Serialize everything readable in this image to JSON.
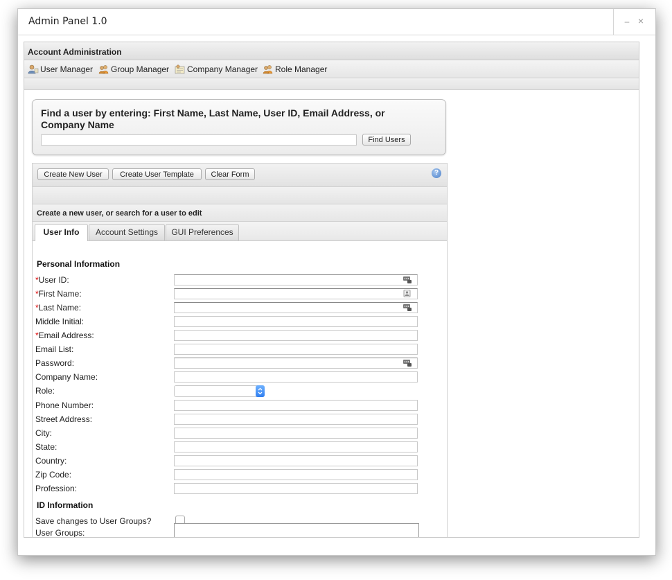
{
  "window": {
    "title": "Admin Panel 1.0",
    "minimize_glyph": "–",
    "close_glyph": "×"
  },
  "header": {
    "section_title": "Account Administration",
    "nav": [
      {
        "label": "User Manager",
        "icon": "user-manager-icon"
      },
      {
        "label": "Group Manager",
        "icon": "group-manager-icon"
      },
      {
        "label": "Company Manager",
        "icon": "company-manager-icon"
      },
      {
        "label": "Role Manager",
        "icon": "role-manager-icon"
      }
    ]
  },
  "search": {
    "heading": "Find a user by entering: First Name, Last Name, User ID, Email Address, or Company Name",
    "input_value": "",
    "button_label": "Find Users"
  },
  "toolbar": {
    "create_user_label": "Create New User",
    "create_template_label": "Create User Template",
    "clear_form_label": "Clear Form",
    "help_glyph": "?"
  },
  "form": {
    "subtitle": "Create a new user, or search for a user to edit",
    "tabs": [
      {
        "label": "User Info",
        "active": true
      },
      {
        "label": "Account Settings",
        "active": false
      },
      {
        "label": "GUI Preferences",
        "active": false
      }
    ],
    "personal_heading": "Personal Information",
    "required_marker": "*",
    "fields": [
      {
        "label": "User ID:",
        "required": true,
        "value": "",
        "icon": "keychain-icon"
      },
      {
        "label": "First Name:",
        "required": true,
        "value": "",
        "icon": "contact-card-icon"
      },
      {
        "label": "Last Name:",
        "required": true,
        "value": "",
        "icon": "keychain-icon"
      },
      {
        "label": "Middle Initial:",
        "required": false,
        "value": ""
      },
      {
        "label": "Email Address:",
        "required": true,
        "value": ""
      },
      {
        "label": "Email List:",
        "required": false,
        "value": ""
      },
      {
        "label": "Password:",
        "required": false,
        "value": "",
        "icon": "keychain-icon"
      },
      {
        "label": "Company Name:",
        "required": false,
        "value": ""
      },
      {
        "label": "Role:",
        "required": false,
        "value": ""
      },
      {
        "label": "Phone Number:",
        "required": false,
        "value": ""
      },
      {
        "label": "Street Address:",
        "required": false,
        "value": ""
      },
      {
        "label": "City:",
        "required": false,
        "value": ""
      },
      {
        "label": "State:",
        "required": false,
        "value": ""
      },
      {
        "label": "Country:",
        "required": false,
        "value": ""
      },
      {
        "label": "Zip Code:",
        "required": false,
        "value": ""
      },
      {
        "label": "Profession:",
        "required": false,
        "value": ""
      }
    ],
    "id_heading": "ID Information",
    "save_groups_label": "Save changes to User Groups?",
    "save_groups_checked": false,
    "user_groups_label": "User Groups:",
    "user_groups_value": ""
  },
  "colors": {
    "required": "#dd0000",
    "select_accent": "#2f7ef0",
    "help_icon": "#4a7fc8"
  }
}
